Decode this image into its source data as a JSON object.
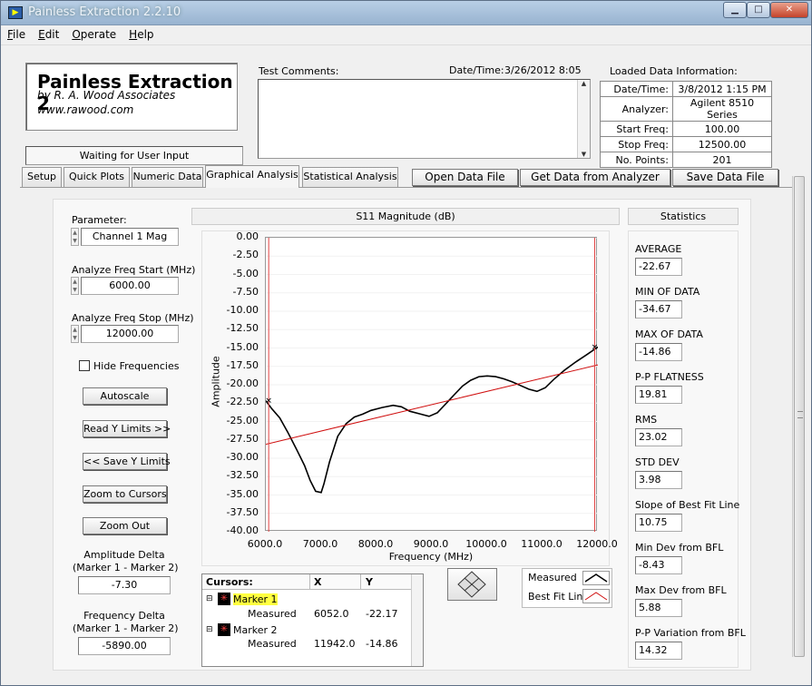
{
  "window": {
    "title": "Painless Extraction 2.2.10"
  },
  "menu": [
    "File",
    "Edit",
    "Operate",
    "Help"
  ],
  "logo": {
    "title": "Painless Extraction 2",
    "by": "by R. A. Wood Associates",
    "url": "www.rawood.com"
  },
  "status": "Waiting for User Input",
  "comments": {
    "label": "Test Comments:",
    "datetime_label": "Date/Time:",
    "datetime_value": "3/26/2012  8:05"
  },
  "loaded": {
    "title": "Loaded Data Information:",
    "rows": [
      {
        "k": "Date/Time:",
        "v": "3/8/2012 1:15 PM"
      },
      {
        "k": "Analyzer:",
        "v": "Agilent 8510 Series"
      },
      {
        "k": "Start Freq:",
        "v": "100.00"
      },
      {
        "k": "Stop Freq:",
        "v": "12500.00"
      },
      {
        "k": "No. Points:",
        "v": "201"
      }
    ]
  },
  "tabs": [
    "Setup",
    "Quick Plots",
    "Numeric Data",
    "Graphical Analysis",
    "Statistical Analysis"
  ],
  "actions": {
    "open": "Open Data File",
    "get": "Get Data from Analyzer",
    "save": "Save Data File"
  },
  "left": {
    "param_label": "Parameter:",
    "param_value": "Channel 1 Mag",
    "start_label": "Analyze Freq Start (MHz)",
    "start_value": "6000.00",
    "stop_label": "Analyze Freq Stop (MHz)",
    "stop_value": "12000.00",
    "hide_label": "Hide Frequencies",
    "autoscale": "Autoscale",
    "read_y": "Read Y Limits >>",
    "save_y": "<< Save Y Limits",
    "zoom_cursors": "Zoom to Cursors",
    "zoom_out": "Zoom Out",
    "amp_delta_l1": "Amplitude Delta",
    "amp_delta_l2": "(Marker 1 - Marker 2)",
    "amp_delta_value": "-7.30",
    "freq_delta_l1": "Frequency Delta",
    "freq_delta_l2": "(Marker 1 - Marker 2)",
    "freq_delta_value": "-5890.00"
  },
  "chart_data": {
    "type": "line",
    "title": "S11 Magnitude (dB)",
    "xlabel": "Frequency (MHz)",
    "ylabel": "Amplitude",
    "xlim": [
      6000,
      12000
    ],
    "ylim": [
      -40,
      0
    ],
    "xticks": [
      "6000.0",
      "7000.0",
      "8000.0",
      "9000.0",
      "10000.0",
      "11000.0",
      "12000.0"
    ],
    "yticks": [
      "0.00",
      "-2.50",
      "-5.00",
      "-7.50",
      "-10.00",
      "-12.50",
      "-15.00",
      "-17.50",
      "-20.00",
      "-22.50",
      "-25.00",
      "-27.50",
      "-30.00",
      "-32.50",
      "-35.00",
      "-37.50",
      "-40.00"
    ],
    "series": [
      {
        "name": "Measured",
        "color": "#000000",
        "x": [
          6000,
          6100,
          6250,
          6400,
          6550,
          6700,
          6800,
          6900,
          7000,
          7050,
          7150,
          7300,
          7450,
          7600,
          7750,
          7900,
          8100,
          8300,
          8450,
          8600,
          8800,
          8950,
          9100,
          9250,
          9400,
          9550,
          9700,
          9850,
          10000,
          10150,
          10300,
          10450,
          10600,
          10750,
          10900,
          11050,
          11200,
          11400,
          11600,
          11800,
          12000
        ],
        "y": [
          -22.17,
          -23.2,
          -24.5,
          -26.5,
          -28.7,
          -31.0,
          -33.0,
          -34.5,
          -34.67,
          -33.5,
          -30.5,
          -27.0,
          -25.3,
          -24.4,
          -24.0,
          -23.5,
          -23.1,
          -22.8,
          -23.0,
          -23.6,
          -24.0,
          -24.3,
          -23.8,
          -22.6,
          -21.4,
          -20.2,
          -19.4,
          -18.9,
          -18.8,
          -18.9,
          -19.2,
          -19.6,
          -20.1,
          -20.6,
          -20.9,
          -20.4,
          -19.3,
          -18.0,
          -16.9,
          -15.9,
          -14.86
        ]
      },
      {
        "name": "Best Fit Line",
        "color": "#d01010",
        "x": [
          6000,
          12000
        ],
        "y": [
          -28.1,
          -17.3
        ]
      }
    ],
    "legend": "bottom"
  },
  "legend": {
    "measured": "Measured",
    "bfl": "Best Fit Line"
  },
  "cursors": {
    "header": {
      "c": "Cursors:",
      "x": "X",
      "y": "Y"
    },
    "marker1": "Marker 1",
    "marker2": "Marker 2",
    "rows": [
      {
        "name": "Measured",
        "x": "6052.0",
        "y": "-22.17"
      },
      {
        "name": "Measured",
        "x": "11942.0",
        "y": "-14.86"
      }
    ]
  },
  "stats": {
    "title": "Statistics",
    "items": [
      {
        "label": "AVERAGE",
        "value": "-22.67"
      },
      {
        "label": "MIN OF DATA",
        "value": "-34.67"
      },
      {
        "label": "MAX OF DATA",
        "value": "-14.86"
      },
      {
        "label": "P-P FLATNESS",
        "value": "19.81"
      },
      {
        "label": "RMS",
        "value": "23.02"
      },
      {
        "label": "STD DEV",
        "value": "3.98"
      },
      {
        "label": "Slope of Best Fit Line",
        "value": "10.75"
      },
      {
        "label": "Min Dev from BFL",
        "value": "-8.43"
      },
      {
        "label": "Max Dev from BFL",
        "value": "5.88"
      },
      {
        "label": "P-P Variation from BFL",
        "value": "14.32"
      }
    ]
  }
}
